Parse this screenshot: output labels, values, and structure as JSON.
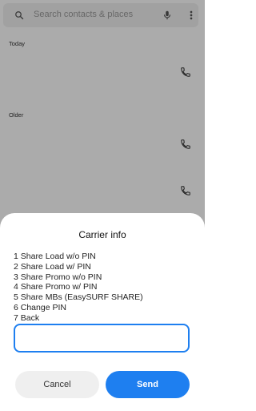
{
  "search": {
    "placeholder": "Search contacts & places",
    "icon": "search-icon",
    "mic_icon": "mic-icon",
    "more_icon": "more-vertical-icon"
  },
  "call_log": {
    "sections": [
      {
        "label": "Today"
      },
      {
        "label": "Older"
      }
    ],
    "call_icon": "phone-icon"
  },
  "dialog": {
    "title": "Carrier info",
    "menu": [
      "1 Share Load w/o PIN",
      "2 Share Load w/ PIN",
      "3 Share Promo w/o PIN",
      "4 Share Promo w/ PIN",
      "5 Share MBs (EasySURF SHARE)",
      "6 Change PIN",
      "7 Back"
    ],
    "input_value": "",
    "cancel_label": "Cancel",
    "send_label": "Send"
  },
  "colors": {
    "accent": "#1e7ff0",
    "scrim": "rgba(0,0,0,0.33)"
  }
}
